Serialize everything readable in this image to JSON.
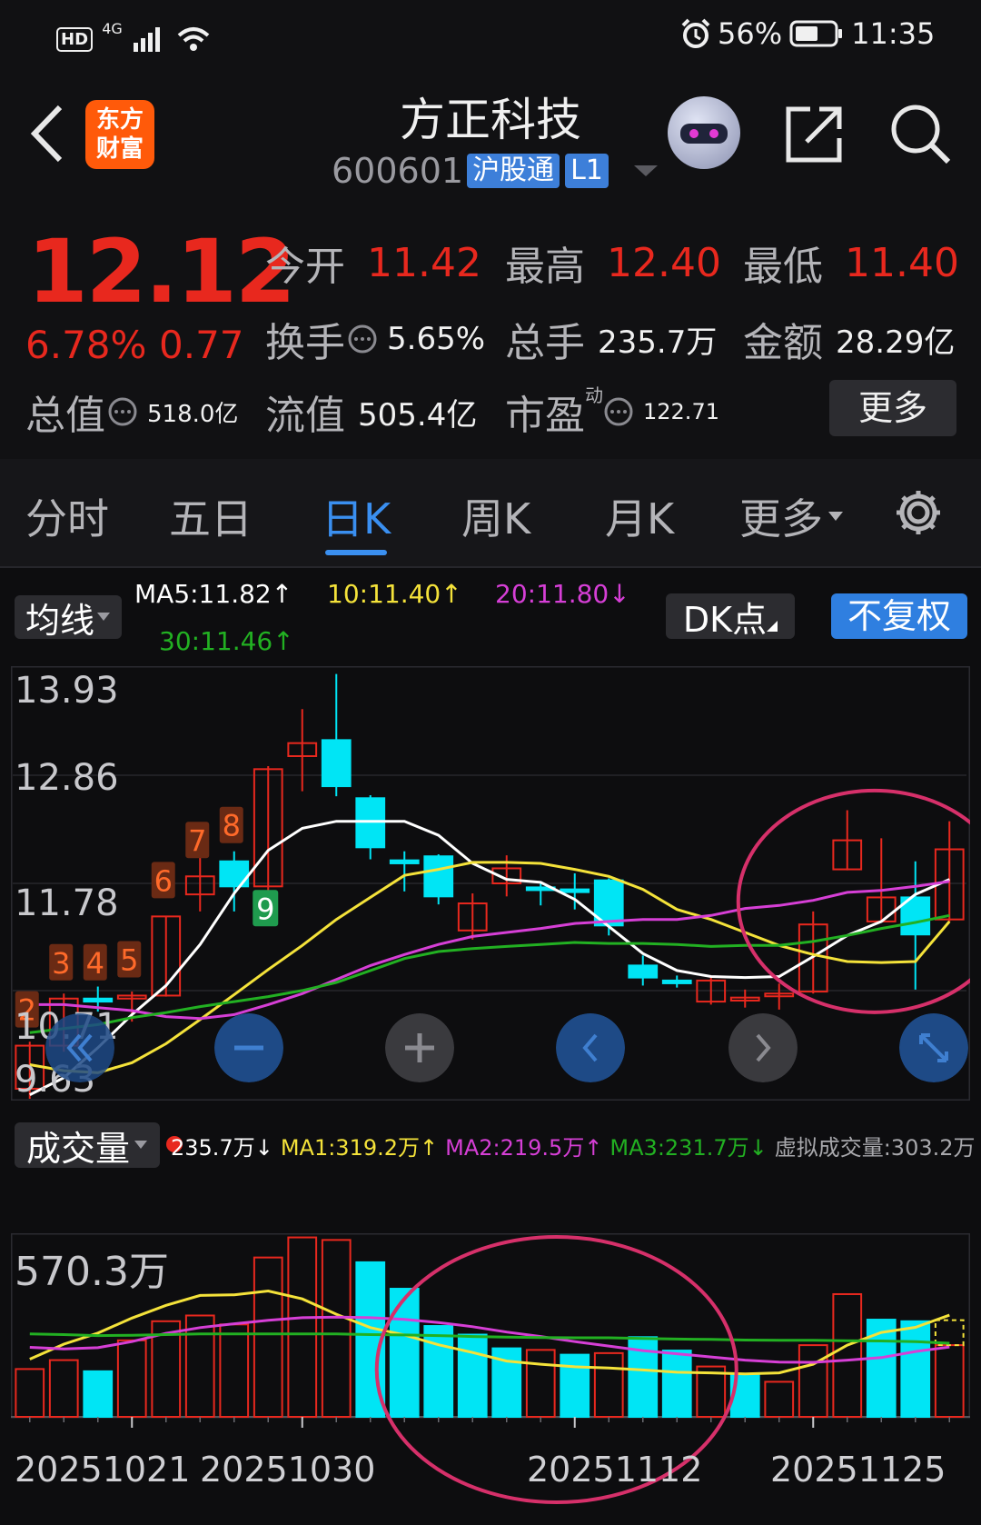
{
  "status_bar": {
    "network_badge": "HD",
    "signal": "4G",
    "alarm_icon": "alarm-clock-icon",
    "battery_percent": "56%",
    "time": "11:35"
  },
  "header": {
    "back_icon": "back-arrow-icon",
    "logo_line1": "东方",
    "logo_line2": "财富",
    "stock_name": "方正科技",
    "stock_code": "600601",
    "tag_connect": "沪股通",
    "tag_level": "L1",
    "share_icon": "share-icon",
    "search_icon": "search-icon"
  },
  "quote": {
    "price": "12.12",
    "change_pct": "6.78%",
    "change_abs": "0.77",
    "open_label": "今开",
    "open": "11.42",
    "high_label": "最高",
    "high": "12.40",
    "low_label": "最低",
    "low": "11.40",
    "turnover_label": "换手",
    "turnover": "5.65%",
    "volume_label": "总手",
    "volume": "235.7万",
    "amount_label": "金额",
    "amount": "28.29亿",
    "mktcap_label": "总值",
    "mktcap": "518.0亿",
    "float_label": "流值",
    "float_cap": "505.4亿",
    "pe_label": "市盈",
    "pe_sup": "动",
    "pe": "122.71",
    "more_button": "更多"
  },
  "tabs": {
    "items": [
      "分时",
      "五日",
      "日K",
      "周K",
      "月K",
      "更多"
    ],
    "active": "日K",
    "settings_icon": "gear-icon"
  },
  "chart_toolbar": {
    "indicator_select": "均线",
    "ma5": "MA5:11.82↑",
    "ma10": "10:11.40↑",
    "ma20": "20:11.80↓",
    "ma30": "30:11.46↑",
    "dk_button": "DK点",
    "adjust_button": "不复权"
  },
  "volume_toolbar": {
    "indicator_select": "成交量",
    "current": "235.7万↓",
    "ma1": "MA1:319.2万↑",
    "ma2": "MA2:219.5万↑",
    "ma3": "MA3:231.7万↓",
    "virtual": "虚拟成交量:303.2万"
  },
  "chart_controls": [
    "double-left-arrow-icon",
    "zoom-out-icon",
    "zoom-in-icon",
    "left-arrow-icon",
    "right-arrow-icon",
    "fullscreen-icon"
  ],
  "colors": {
    "up": "#e8281e",
    "down": "#00e5f5",
    "ma5": "#ffffff",
    "ma10": "#f4e23a",
    "ma20": "#d63fd6",
    "ma30": "#22b022",
    "accent": "#3a8ff0",
    "annotation": "#d6306a"
  },
  "chart_data": [
    {
      "type": "candlestick",
      "y_ticks": [
        "13.93",
        "12.86",
        "11.78",
        "10.71",
        "9.63"
      ],
      "ylim": [
        9.63,
        13.93
      ],
      "candles": [
        {
          "o": 9.73,
          "c": 10.16,
          "h": 10.2,
          "l": 9.63
        },
        {
          "o": 10.16,
          "c": 10.63,
          "h": 10.68,
          "l": 10.1
        },
        {
          "o": 10.63,
          "c": 10.6,
          "h": 10.75,
          "l": 10.5
        },
        {
          "o": 10.63,
          "c": 10.66,
          "h": 10.7,
          "l": 10.4
        },
        {
          "o": 10.66,
          "c": 11.45,
          "h": 11.45,
          "l": 10.65
        },
        {
          "o": 11.67,
          "c": 11.85,
          "h": 12.05,
          "l": 11.5
        },
        {
          "o": 12.0,
          "c": 11.75,
          "h": 12.1,
          "l": 11.5
        },
        {
          "o": 11.75,
          "c": 12.92,
          "h": 12.95,
          "l": 11.7
        },
        {
          "o": 13.05,
          "c": 13.18,
          "h": 13.52,
          "l": 12.7
        },
        {
          "o": 13.21,
          "c": 12.75,
          "h": 13.87,
          "l": 12.65
        },
        {
          "o": 12.63,
          "c": 12.14,
          "h": 12.66,
          "l": 12.02
        },
        {
          "o": 12.01,
          "c": 11.98,
          "h": 12.1,
          "l": 11.7
        },
        {
          "o": 12.05,
          "c": 11.65,
          "h": 12.07,
          "l": 11.57
        },
        {
          "o": 11.31,
          "c": 11.58,
          "h": 11.68,
          "l": 11.22
        },
        {
          "o": 11.78,
          "c": 11.93,
          "h": 12.06,
          "l": 11.65
        },
        {
          "o": 11.74,
          "c": 11.73,
          "h": 11.8,
          "l": 11.56
        },
        {
          "o": 11.72,
          "c": 11.71,
          "h": 11.88,
          "l": 11.52
        },
        {
          "o": 11.81,
          "c": 11.36,
          "h": 11.83,
          "l": 11.26
        },
        {
          "o": 10.96,
          "c": 10.84,
          "h": 11.06,
          "l": 10.76
        },
        {
          "o": 10.81,
          "c": 10.8,
          "h": 10.86,
          "l": 10.74
        },
        {
          "o": 10.6,
          "c": 10.81,
          "h": 10.84,
          "l": 10.57
        },
        {
          "o": 10.61,
          "c": 10.64,
          "h": 10.72,
          "l": 10.54
        },
        {
          "o": 10.66,
          "c": 10.68,
          "h": 10.78,
          "l": 10.52
        },
        {
          "o": 10.7,
          "c": 11.37,
          "h": 11.5,
          "l": 10.68
        },
        {
          "o": 11.92,
          "c": 12.21,
          "h": 12.51,
          "l": 11.91
        },
        {
          "o": 11.4,
          "c": 11.64,
          "h": 12.23,
          "l": 11.4
        },
        {
          "o": 11.64,
          "c": 11.27,
          "h": 12.0,
          "l": 10.72
        },
        {
          "o": 11.42,
          "c": 12.12,
          "h": 12.4,
          "l": 11.4
        }
      ],
      "up_markers": [
        {
          "index": 0,
          "label": "2"
        },
        {
          "index": 1,
          "label": "3"
        },
        {
          "index": 2,
          "label": "4"
        },
        {
          "index": 3,
          "label": "5"
        },
        {
          "index": 4,
          "label": "6"
        },
        {
          "index": 5,
          "label": "7"
        },
        {
          "index": 6,
          "label": "8"
        }
      ],
      "down_marker": {
        "index": 7,
        "label": "9"
      },
      "series": [
        {
          "name": "MA5",
          "values": [
            9.67,
            9.84,
            10.14,
            10.47,
            10.76,
            11.17,
            11.68,
            12.11,
            12.33,
            12.4,
            12.4,
            12.4,
            12.26,
            11.98,
            11.82,
            11.79,
            11.62,
            11.35,
            11.08,
            10.91,
            10.85,
            10.84,
            10.85,
            11.05,
            11.26,
            11.4,
            11.67,
            11.82
          ]
        },
        {
          "name": "10",
          "values": [
            9.97,
            9.91,
            9.89,
            9.99,
            10.18,
            10.42,
            10.67,
            10.92,
            11.16,
            11.42,
            11.64,
            11.86,
            11.92,
            11.99,
            11.99,
            11.98,
            11.92,
            11.85,
            11.72,
            11.52,
            11.42,
            11.29,
            11.16,
            11.07,
            11.0,
            10.99,
            11.0,
            11.4
          ]
        },
        {
          "name": "20",
          "values": [
            10.57,
            10.57,
            10.54,
            10.51,
            10.45,
            10.43,
            10.47,
            10.57,
            10.68,
            10.82,
            10.96,
            11.07,
            11.17,
            11.25,
            11.29,
            11.33,
            11.38,
            11.4,
            11.42,
            11.42,
            11.46,
            11.53,
            11.56,
            11.61,
            11.69,
            11.71,
            11.75,
            11.8
          ]
        },
        {
          "name": "30",
          "values": [
            10.29,
            10.33,
            10.37,
            10.44,
            10.49,
            10.55,
            10.6,
            10.65,
            10.71,
            10.79,
            10.91,
            11.03,
            11.1,
            11.13,
            11.15,
            11.17,
            11.19,
            11.18,
            11.18,
            11.17,
            11.15,
            11.16,
            11.16,
            11.2,
            11.26,
            11.33,
            11.39,
            11.46
          ]
        }
      ],
      "annotation": "circle around the last six sessions"
    },
    {
      "type": "bar",
      "ylim": [
        0,
        570.3
      ],
      "y_ticks": [
        "570.3万"
      ],
      "x_ticks": [
        "20251021",
        "20251030",
        "20251112",
        "20251125"
      ],
      "x_tick_index": [
        3,
        8,
        16,
        23
      ],
      "bars": [
        {
          "v": 150,
          "up": true
        },
        {
          "v": 178,
          "up": true
        },
        {
          "v": 143,
          "up": false
        },
        {
          "v": 240,
          "up": true
        },
        {
          "v": 300,
          "up": true
        },
        {
          "v": 318,
          "up": true
        },
        {
          "v": 290,
          "up": true
        },
        {
          "v": 500,
          "up": true
        },
        {
          "v": 563,
          "up": true
        },
        {
          "v": 555,
          "up": true
        },
        {
          "v": 485,
          "up": false
        },
        {
          "v": 402,
          "up": false
        },
        {
          "v": 285,
          "up": false
        },
        {
          "v": 258,
          "up": false
        },
        {
          "v": 215,
          "up": false
        },
        {
          "v": 210,
          "up": true
        },
        {
          "v": 195,
          "up": false
        },
        {
          "v": 200,
          "up": true
        },
        {
          "v": 250,
          "up": false
        },
        {
          "v": 208,
          "up": false
        },
        {
          "v": 158,
          "up": true
        },
        {
          "v": 133,
          "up": false
        },
        {
          "v": 110,
          "up": true
        },
        {
          "v": 225,
          "up": true
        },
        {
          "v": 385,
          "up": true
        },
        {
          "v": 305,
          "up": false
        },
        {
          "v": 300,
          "up": false
        },
        {
          "v": 225,
          "up": true
        }
      ],
      "virtual_volume": 303.2,
      "series": [
        {
          "name": "MA1",
          "values": [
            181,
            228,
            263,
            310,
            350,
            381,
            383,
            395,
            370,
            322,
            280,
            257,
            226,
            202,
            175,
            165,
            157,
            153,
            147,
            140,
            138,
            135,
            138,
            165,
            225,
            265,
            281,
            319
          ]
        },
        {
          "name": "MA2",
          "values": [
            218,
            213,
            217,
            236,
            262,
            280,
            292,
            303,
            311,
            313,
            311,
            306,
            296,
            283,
            266,
            252,
            236,
            222,
            208,
            198,
            188,
            178,
            172,
            171,
            178,
            186,
            205,
            219
          ]
        },
        {
          "name": "MA3",
          "values": [
            260,
            258,
            255,
            256,
            258,
            260,
            260,
            260,
            260,
            260,
            258,
            257,
            255,
            252,
            250,
            249,
            248,
            248,
            246,
            244,
            243,
            241,
            240,
            240,
            239,
            238,
            236,
            231
          ]
        }
      ],
      "annotation": "circle around the low-volume sessions"
    }
  ]
}
